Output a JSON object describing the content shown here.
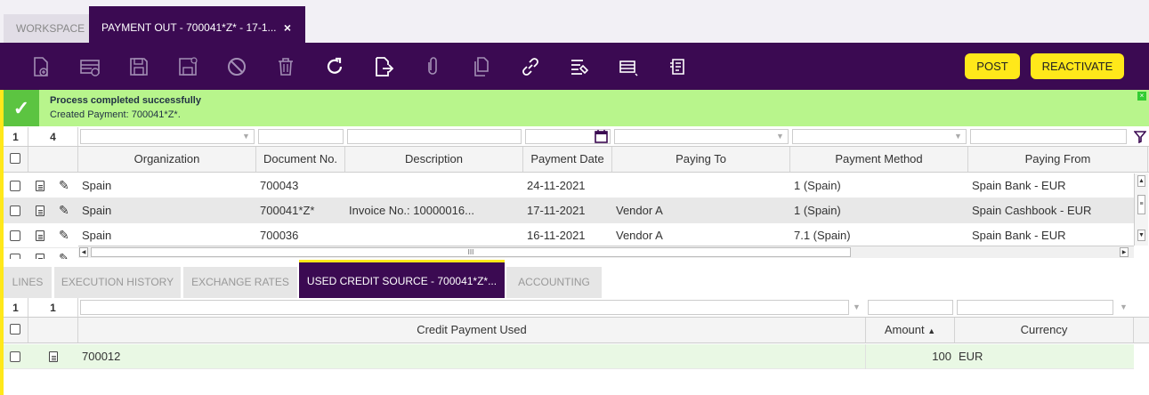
{
  "tabs": {
    "workspace": "WORKSPACE",
    "active": "PAYMENT OUT - 700041*Z* - 17-1...",
    "close": "×"
  },
  "toolbar": {
    "post_label": "POST",
    "reactivate_label": "REACTIVATE"
  },
  "message": {
    "title": "Process completed successfully",
    "text": "Created Payment: 700041*Z*."
  },
  "main_grid": {
    "selected_count": "1",
    "total_count": "4",
    "columns": [
      "Organization",
      "Document No.",
      "Description",
      "Payment Date",
      "Paying To",
      "Payment Method",
      "Paying From"
    ],
    "rows": [
      [
        "Spain",
        "700043",
        "",
        "24-11-2021",
        "",
        "1 (Spain)",
        "Spain Bank - EUR"
      ],
      [
        "Spain",
        "700041*Z*",
        "Invoice No.: 10000016...",
        "17-11-2021",
        "Vendor A",
        "1 (Spain)",
        "Spain Cashbook - EUR"
      ],
      [
        "Spain",
        "700036",
        "",
        "16-11-2021",
        "Vendor A",
        "7.1 (Spain)",
        "Spain Bank - EUR"
      ]
    ],
    "hscroll_grip": "III"
  },
  "subtabs": [
    "LINES",
    "EXECUTION HISTORY",
    "EXCHANGE RATES",
    "USED CREDIT SOURCE - 700041*Z*...",
    "ACCOUNTING"
  ],
  "credit_grid": {
    "selected_count": "1",
    "total_count": "1",
    "columns": [
      "Credit Payment Used",
      "Amount",
      "Currency"
    ],
    "sort_indicator": "▲",
    "rows": [
      [
        "700012",
        "100",
        "EUR"
      ]
    ]
  }
}
